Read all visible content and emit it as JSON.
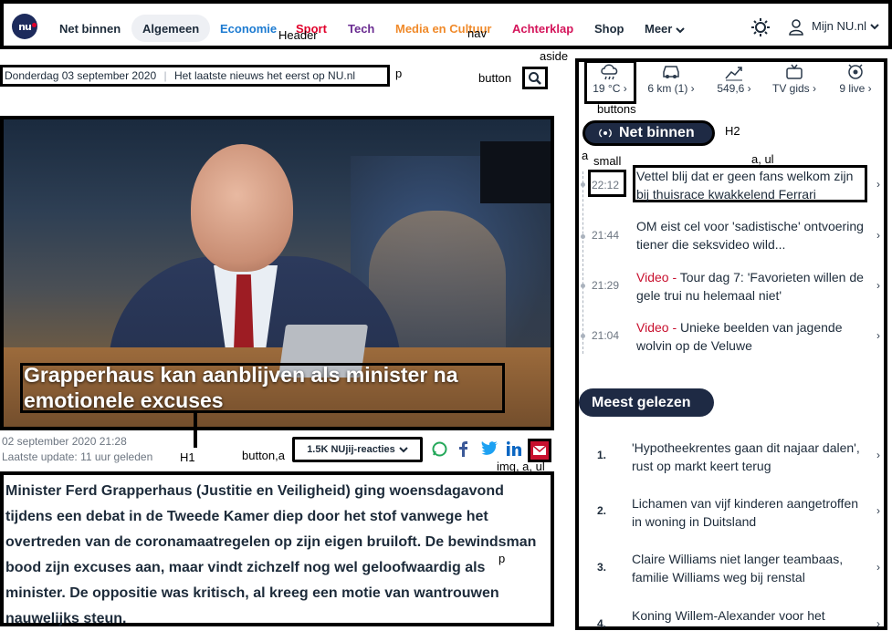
{
  "header": {
    "annotation": "Header",
    "logo_text": "nu",
    "nav_annotation": "nav",
    "nav": [
      {
        "label": "Net binnen",
        "color": "#1d2b3a"
      },
      {
        "label": "Algemeen",
        "color": "#1d2b3a"
      },
      {
        "label": "Economie",
        "color": "#1d7bd1"
      },
      {
        "label": "Sport",
        "color": "#e1002b"
      },
      {
        "label": "Tech",
        "color": "#6a2c91"
      },
      {
        "label": "Media en Cultuur",
        "color": "#f08a2a"
      },
      {
        "label": "Achterklap",
        "color": "#d4145a"
      },
      {
        "label": "Shop",
        "color": "#1d2b3a"
      },
      {
        "label": "Meer",
        "color": "#1d2b3a"
      }
    ],
    "theme_icon": "sun-icon",
    "account_label": "Mijn NU.nl"
  },
  "datebar": {
    "date": "Donderdag 03 september 2020",
    "tagline": "Het laatste nieuws het eerst op NU.nl",
    "annotation": "p"
  },
  "search": {
    "annotation": "button",
    "icon": "search-icon"
  },
  "article": {
    "title": "Grapperhaus kan aanblijven als minister na emotionele excuses",
    "title_annotation": "H1",
    "date": "02 september 2020 21:28",
    "updated": "Laatste update: 11 uur geleden",
    "reactions_annotation": "button,a",
    "reactions_label": "1.5K NUjij-reacties",
    "share_annotation": "img, a, ul",
    "share_icons": [
      "whatsapp-icon",
      "facebook-icon",
      "twitter-icon",
      "linkedin-icon",
      "mail-icon"
    ],
    "lead": "Minister Ferd Grapperhaus (Justitie en Veiligheid) ging woensdagavond tijdens een debat in de Tweede Kamer diep door het stof vanwege het overtreden van de coronamaatregelen op zijn eigen bruiloft. De bewindsman bood zijn excuses aan, maar vindt zichzelf nog wel geloofwaardig als minister. De oppositie was kritisch, al kreeg een motie van wantrouwen nauwelijks steun.",
    "lead_annotation": "p"
  },
  "aside": {
    "annotation": "aside",
    "buttons_annotation": "buttons",
    "buttons": [
      {
        "icon": "weather-icon",
        "label": "19 °C ›"
      },
      {
        "icon": "traffic-icon",
        "label": "6 km (1) ›"
      },
      {
        "icon": "stocks-icon",
        "label": "549,6 ›"
      },
      {
        "icon": "tv-icon",
        "label": "TV gids ›"
      },
      {
        "icon": "live-icon",
        "label": "9 live ›"
      }
    ],
    "net_binnen": {
      "title": "Net binnen",
      "h2_annotation": "H2",
      "small_annotation": "small",
      "aul_annotation": "a, ul",
      "a_annotation": "a",
      "items": [
        {
          "time": "22:12",
          "prefix": "",
          "text": "Vettel blij dat er geen fans welkom zijn bij thuisrace kwakkelend Ferrari"
        },
        {
          "time": "21:44",
          "prefix": "",
          "text": "OM eist cel voor 'sadistische' ontvoering tiener die seksvideo wild..."
        },
        {
          "time": "21:29",
          "prefix": "Video",
          "text": "Tour dag 7: 'Favorieten willen de gele trui nu helemaal niet'"
        },
        {
          "time": "21:04",
          "prefix": "Video",
          "text": "Unieke beelden van jagende wolvin op de Veluwe"
        }
      ]
    },
    "meest_gelezen": {
      "title": "Meest gelezen",
      "items": [
        {
          "num": "1.",
          "text": "'Hypotheekrentes gaan dit najaar dalen', rust op markt keert terug"
        },
        {
          "num": "2.",
          "text": "Lichamen van vijf kinderen aangetroffen in woning in Duitsland"
        },
        {
          "num": "3.",
          "text": "Claire Williams niet langer teambaas, familie Williams weg bij renstal"
        },
        {
          "num": "4.",
          "text": "Koning Willem-Alexander voor het"
        }
      ]
    }
  }
}
